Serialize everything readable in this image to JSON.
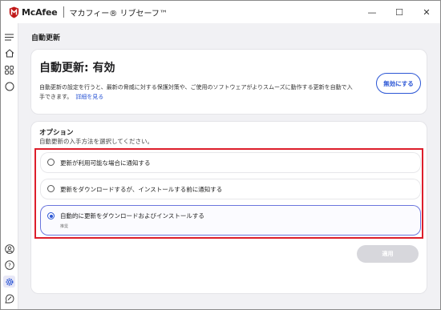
{
  "app": {
    "brand": "McAfee",
    "product": "マカフィー® リブセーフ™",
    "colors": {
      "brand_red": "#c01818",
      "accent": "#2b56d5",
      "highlight": "#dd1e2b"
    }
  },
  "window_controls": {
    "minimize": "—",
    "maximize": "☐",
    "close": "✕"
  },
  "sidebar": {
    "icons": [
      "menu-icon",
      "home-icon",
      "apps-grid-icon",
      "circle-icon",
      "account-icon",
      "help-icon",
      "settings-icon",
      "feedback-icon"
    ]
  },
  "page": {
    "title": "自動更新"
  },
  "status": {
    "title": "自動更新: 有効",
    "description": "自動更新の設定を行うと、最新の脅威に対する保護対策や、ご使用のソフトウェアがよりスムーズに動作する更新を自動で入手できます。",
    "link": "詳細を見る",
    "disable_button": "無効にする"
  },
  "options": {
    "title": "オプション",
    "subtitle": "自動更新の入手方法を選択してください。",
    "items": [
      {
        "label": "更新が利用可能な場合に通知する",
        "selected": false,
        "note": ""
      },
      {
        "label": "更新をダウンロードするが、インストールする前に通知する",
        "selected": false,
        "note": ""
      },
      {
        "label": "自動的に更新をダウンロードおよびインストールする",
        "selected": true,
        "note": "推奨"
      }
    ],
    "apply_button": "適用"
  }
}
